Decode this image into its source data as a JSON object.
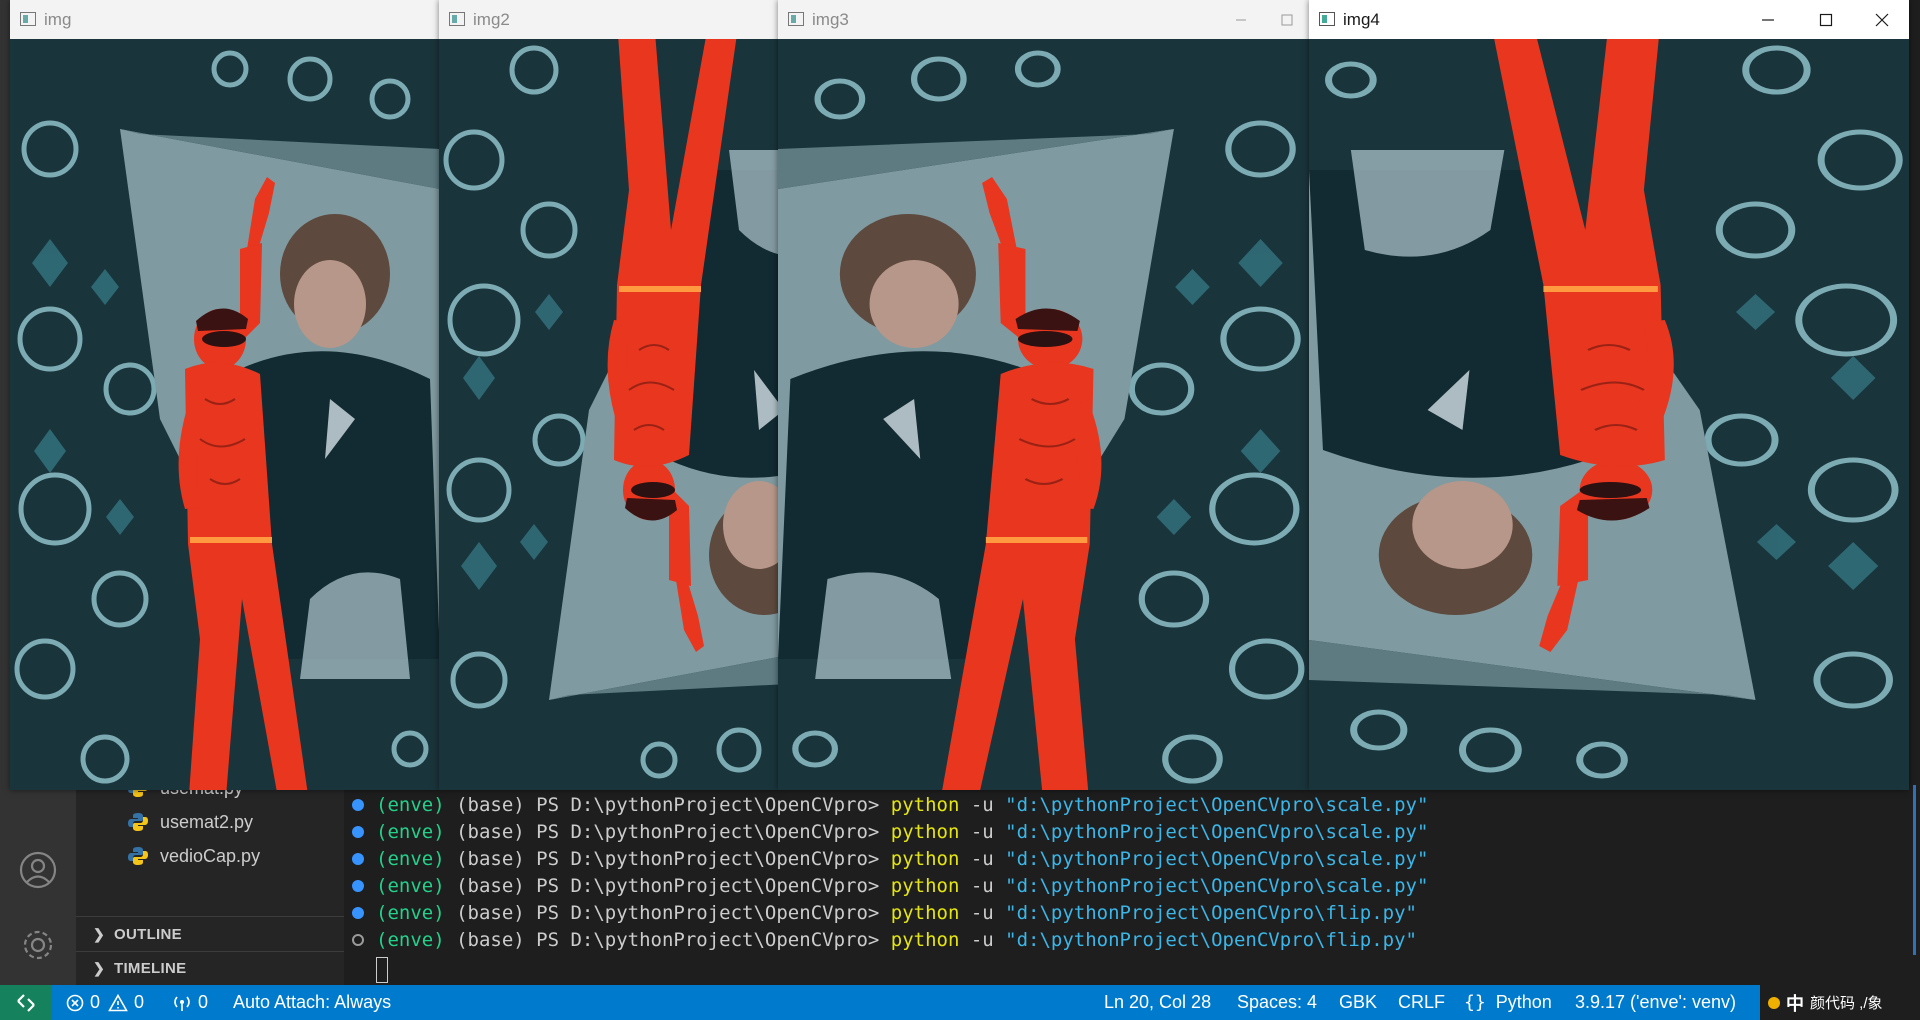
{
  "vscode": {
    "sidebar": {
      "files": [
        "usemat.py",
        "usemat2.py",
        "vedioCap.py"
      ],
      "sections": [
        "OUTLINE",
        "TIMELINE"
      ]
    },
    "terminal": {
      "lines": [
        {
          "env": "(enve)",
          "prompt": " (base) PS D:\\pythonProject\\OpenCVpro> ",
          "cmd": "python",
          "args": " -u ",
          "path": "\"d:\\pythonProject\\OpenCVpro\\scale.py\"",
          "status": "done"
        },
        {
          "env": "(enve)",
          "prompt": " (base) PS D:\\pythonProject\\OpenCVpro> ",
          "cmd": "python",
          "args": " -u ",
          "path": "\"d:\\pythonProject\\OpenCVpro\\scale.py\"",
          "status": "done"
        },
        {
          "env": "(enve)",
          "prompt": " (base) PS D:\\pythonProject\\OpenCVpro> ",
          "cmd": "python",
          "args": " -u ",
          "path": "\"d:\\pythonProject\\OpenCVpro\\scale.py\"",
          "status": "done"
        },
        {
          "env": "(enve)",
          "prompt": " (base) PS D:\\pythonProject\\OpenCVpro> ",
          "cmd": "python",
          "args": " -u ",
          "path": "\"d:\\pythonProject\\OpenCVpro\\scale.py\"",
          "status": "done"
        },
        {
          "env": "(enve)",
          "prompt": " (base) PS D:\\pythonProject\\OpenCVpro> ",
          "cmd": "python",
          "args": " -u ",
          "path": "\"d:\\pythonProject\\OpenCVpro\\flip.py\"",
          "status": "done"
        },
        {
          "env": "(enve)",
          "prompt": " (base) PS D:\\pythonProject\\OpenCVpro> ",
          "cmd": "python",
          "args": " -u ",
          "path": "\"d:\\pythonProject\\OpenCVpro\\flip.py\"",
          "status": "running"
        }
      ]
    },
    "status_bar": {
      "errors": "0",
      "warnings": "0",
      "ports": "0",
      "auto_attach": "Auto Attach: Always",
      "position": "Ln 20, Col 28",
      "spaces": "Spaces: 4",
      "encoding": "GBK",
      "eol": "CRLF",
      "language": "Python",
      "interpreter": "3.9.17 ('enve': venv)",
      "ime_mode": "中",
      "ime_extra": "颜代码 ,/象"
    }
  },
  "windows": [
    {
      "title": "img"
    },
    {
      "title": "img2"
    },
    {
      "title": "img3"
    },
    {
      "title": "img4",
      "active": true
    }
  ],
  "colors": {
    "status_bar": "#007acc",
    "remote_button": "#16825d",
    "terminal_env": "#23d18b",
    "terminal_cmd": "#e5e510",
    "terminal_string": "#3bb6e8",
    "figure_red": "#e8361f",
    "background_teal": "#1c3e46"
  }
}
